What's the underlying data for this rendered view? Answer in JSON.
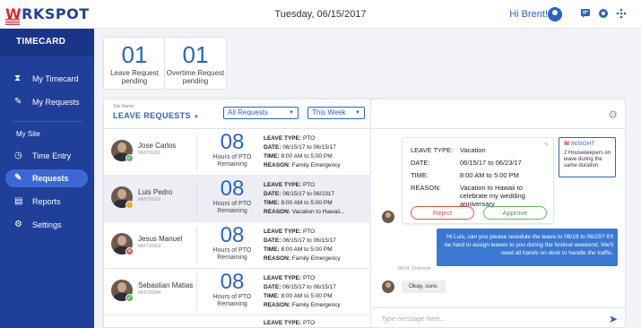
{
  "app": {
    "logo": "WRKSPOT",
    "logo_accent": "W",
    "logo_rest": "RKSPOT"
  },
  "header": {
    "date": "Tuesday, 06/15/2017",
    "greeting": "Hi Brent!"
  },
  "sidebar": {
    "title": "TIMECARD",
    "items": [
      {
        "label": "My Timecard",
        "icon": "hourglass-icon"
      },
      {
        "label": "My Requests",
        "icon": "edit-icon"
      },
      {
        "label": "Time Entry",
        "icon": "stopwatch-icon"
      },
      {
        "label": "Requests",
        "icon": "edit-icon"
      },
      {
        "label": "Reports",
        "icon": "report-icon"
      },
      {
        "label": "Settings",
        "icon": "gear-icon"
      }
    ],
    "section": "My Site"
  },
  "summary": {
    "leave_count": "01",
    "leave_label_1": "Leave Request",
    "leave_label_2": "pending",
    "overtime_count": "01",
    "overtime_label_1": "Overtime Request",
    "overtime_label_2": "pending"
  },
  "list": {
    "site_label": "Site Name",
    "title": "LEAVE REQUESTS",
    "filter": "All Requests",
    "period": "This Week",
    "hours_label_1": "Hours of PTO",
    "hours_label_2": "Remaining",
    "key_type": "LEAVE TYPE:",
    "key_date": "DATE:",
    "key_time": "TIME:",
    "key_reason": "REASON:",
    "rows": [
      {
        "name": "Jose Carlos",
        "id": "MMT00001",
        "hours": "08",
        "status": "approved",
        "type": "PTO",
        "date": "06/15/17 to 06/15/17",
        "time": "8:00 AM to 5:00 PM",
        "reason": "Family Emergency"
      },
      {
        "name": "Luis Pedro",
        "id": "MMT00002",
        "hours": "08",
        "status": "pending",
        "type": "PTO",
        "date": "06/15/17 to 06/2317",
        "time": "8:00 AM to 5:00 PM",
        "reason": "Vacation to Hawaii..."
      },
      {
        "name": "Jesus Manuel",
        "id": "MMT00003",
        "hours": "08",
        "status": "rejected",
        "type": "PTO",
        "date": "06/15/17 to 06/15/17",
        "time": "8:00 AM to 5:00 PM",
        "reason": "Family Emergency"
      },
      {
        "name": "Sebastian Matias",
        "id": "MMT00004",
        "hours": "08",
        "status": "approved",
        "type": "PTO",
        "date": "06/15/17 to 06/15/17",
        "time": "8:00 AM to 5:00 PM",
        "reason": "Family Emergency"
      },
      {
        "type": "PTO"
      }
    ]
  },
  "chat": {
    "leave_card": {
      "k_type": "LEAVE TYPE:",
      "v_type": "Vacation",
      "k_date": "DATE:",
      "v_date": "06/15/17 to 06/23/17",
      "k_time": "TIME:",
      "v_time": "8:00 AM to 5:00 PM",
      "k_reason": "REASON:",
      "v_reason": "Vacation to Hawaii to celebrate my wedding anniversary",
      "reject": "Reject",
      "approve": "Approve"
    },
    "insight": {
      "title": "INSIGHT",
      "text": "2 Housekeepers on leave during the same duration"
    },
    "message_out": "Hi Luis, can you please resedule the leave to 06/19 to 06/25? It'll be hard to assign leaves to you during the festival weekend. We'll need all hands on deck to handle the traffic.",
    "delivered": "06/14, Delivered",
    "message_in": "Okay, sure.",
    "input_placeholder": "Type message here..."
  },
  "colors": {
    "brand": "#1f3f99",
    "accent": "#2a63c7",
    "approve": "#5cb85c",
    "reject": "#d9534f",
    "pending": "#f0a020"
  }
}
